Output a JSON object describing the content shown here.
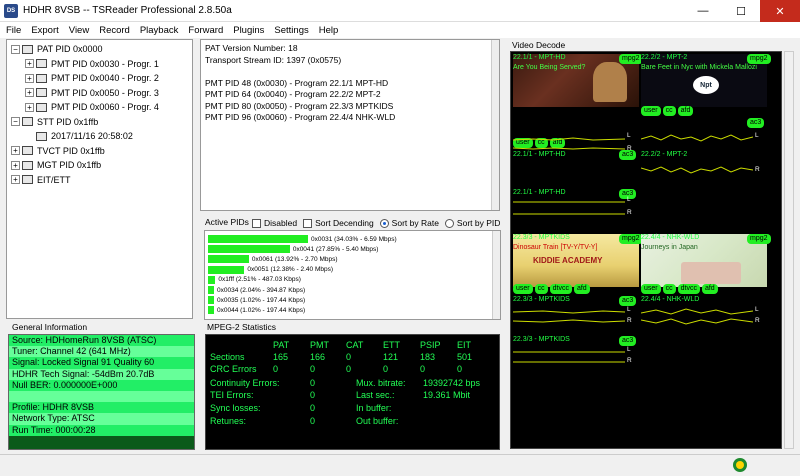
{
  "window": {
    "title": "HDHR 8VSB -- TSReader Professional 2.8.50a",
    "icon_text": "DS"
  },
  "menu": [
    "File",
    "Export",
    "View",
    "Record",
    "Playback",
    "Forward",
    "Plugins",
    "Settings",
    "Help"
  ],
  "tree": [
    {
      "label": "PAT PID 0x0000",
      "indent": 0,
      "expander": "−"
    },
    {
      "label": "PMT PID 0x0030 - Progr. 1",
      "indent": 1,
      "expander": "+"
    },
    {
      "label": "PMT PID 0x0040 - Progr. 2",
      "indent": 1,
      "expander": "+"
    },
    {
      "label": "PMT PID 0x0050 - Progr. 3",
      "indent": 1,
      "expander": "+"
    },
    {
      "label": "PMT PID 0x0060 - Progr. 4",
      "indent": 1,
      "expander": "+"
    },
    {
      "label": "STT PID 0x1ffb",
      "indent": 0,
      "expander": "−"
    },
    {
      "label": "2017/11/16 20:58:02",
      "indent": 1,
      "expander": ""
    },
    {
      "label": "TVCT PID 0x1ffb",
      "indent": 0,
      "expander": "+"
    },
    {
      "label": "MGT PID 0x1ffb",
      "indent": 0,
      "expander": "+"
    },
    {
      "label": "EIT/ETT",
      "indent": 0,
      "expander": "+"
    }
  ],
  "info": {
    "lines": [
      "PAT Version Number: 18",
      "Transport Stream ID: 1397 (0x0575)",
      "",
      "PMT PID 48 (0x0030) - Program 22.1/1 MPT-HD",
      "PMT PID 64 (0x0040) - Program 22.2/2 MPT-2",
      "PMT PID 80 (0x0050) - Program 22.3/3 MPTKIDS",
      "PMT PID 96 (0x0060) - Program 22.4/4 NHK-WLD"
    ]
  },
  "active_pids": {
    "title": "Active PIDs",
    "disabled": "Disabled",
    "sort_descending": "Sort Decending",
    "sort_by_rate": "Sort by Rate",
    "sort_by_pid": "Sort by PID",
    "rows": [
      {
        "label": "0x0031 (34.03% - 6.59 Mbps)",
        "percent": 34.03
      },
      {
        "label": "0x0041 (27.85% - 5.40 Mbps)",
        "percent": 27.85
      },
      {
        "label": "0x0061 (13.92% - 2.70 Mbps)",
        "percent": 13.92
      },
      {
        "label": "0x0051 (12.38% - 2.40 Mbps)",
        "percent": 12.38
      },
      {
        "label": "0x1fff (2.51% - 487.03 Kbps)",
        "percent": 2.51
      },
      {
        "label": "0x0034 (2.04% - 394.87 Kbps)",
        "percent": 2.04
      },
      {
        "label": "0x0035 (1.02% - 197.44 Kbps)",
        "percent": 1.02
      },
      {
        "label": "0x0044 (1.02% - 197.44 Kbps)",
        "percent": 1.02
      }
    ]
  },
  "general": {
    "title": "General Information",
    "rows": [
      "Source: HDHomeRun 8VSB (ATSC)",
      "Tuner: Channel 42 (641 MHz)",
      "Signal: Locked Signal 91 Quality 60",
      "HDHR Tech Signal: -54dBm 20.7dB",
      "Null BER: 0.000000E+000",
      "",
      "Profile: HDHR 8VSB",
      "Network Type: ATSC",
      "Run Time: 000:00:28"
    ]
  },
  "stats": {
    "title": "MPEG-2 Statistics",
    "headers": [
      "PAT",
      "PMT",
      "CAT",
      "ETT",
      "PSIP",
      "EIT"
    ],
    "sections_label": "Sections",
    "sections": [
      "165",
      "166",
      "0",
      "121",
      "183",
      "501"
    ],
    "crc_label": "CRC Errors",
    "crc": [
      "0",
      "0",
      "0",
      "0",
      "0",
      "0"
    ],
    "continuity_label": "Continuity Errors:",
    "continuity": "0",
    "tei_label": "TEI Errors:",
    "tei": "0",
    "sync_label": "Sync losses:",
    "sync": "0",
    "retunes_label": "Retunes:",
    "retunes": "0",
    "mux_label": "Mux. bitrate:",
    "mux": "19392742 bps",
    "last_label": "Last sec.:",
    "last": "19.361 Mbit",
    "inbuf_label": "In buffer:",
    "outbuf_label": "Out buffer:"
  },
  "video": {
    "title": "Video Decode",
    "thumb1": {
      "label": "22.1/1 - MPT-HD",
      "sub": "Are You Being Served?",
      "codec": "mpg2"
    },
    "thumb2": {
      "label": "22.2/2 - MPT-2",
      "sub": "Bare Feet in Nyc with Mickela Mallozi",
      "codec": "mpg2"
    },
    "thumb3": {
      "label": "22.3/3 - MPTKIDS",
      "sub": "Dinosaur Train [TV-Y/TV-Y]",
      "codec": "mpg2"
    },
    "thumb4": {
      "label": "22.4/4 - NHK-WLD",
      "sub": "Journeys in Japan",
      "codec": "mpg2"
    },
    "audio_rows": [
      {
        "left_label": "22.1/1 - MPT-HD",
        "right_label": "22.2/2 - MPT-2"
      },
      {
        "left_label": "22.1/1 - MPT-HD",
        "right_label": ""
      },
      {
        "left_label": "22.3/3 - MPTKIDS",
        "right_label": "22.4/4 - NHK-WLD"
      },
      {
        "left_label": "22.3/3 - MPTKIDS",
        "right_label": ""
      }
    ],
    "tag_ac3": "ac3",
    "pills": [
      "user",
      "cc",
      "afd"
    ],
    "pills_kids": [
      "user",
      "cc",
      "dtvcc",
      "afd"
    ],
    "pills_nhk": [
      "user",
      "cc",
      "dtvcc",
      "afd"
    ],
    "ch_l": "L",
    "ch_r": "R",
    "kids_logo": "KIDDIE ACADEMY",
    "npt_logo": "Npt"
  },
  "colors": {
    "accent_green": "#22ee22",
    "stats_bg": "#000000",
    "general_bg": "#0b5a1a"
  }
}
